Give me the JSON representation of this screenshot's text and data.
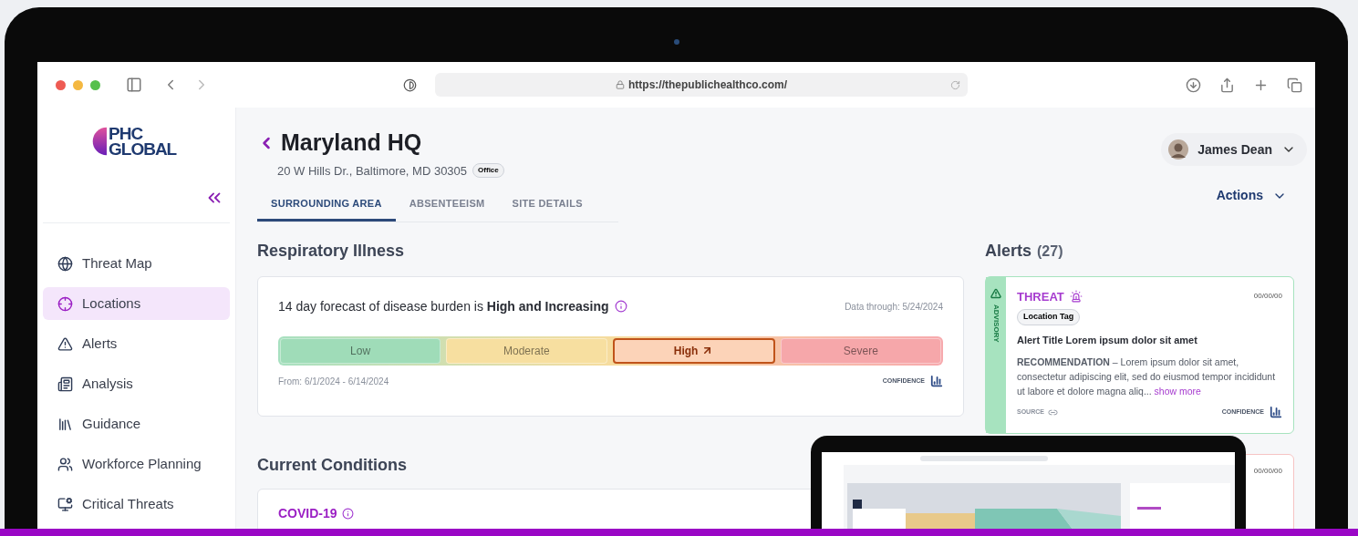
{
  "browser": {
    "url": "https://thepublichealthco.com/"
  },
  "sidebar": {
    "logo": [
      "PHC",
      "GLOBAL"
    ],
    "items": [
      {
        "label": "Threat Map",
        "selected": false
      },
      {
        "label": "Locations",
        "selected": true
      },
      {
        "label": "Alerts",
        "selected": false
      },
      {
        "label": "Analysis",
        "selected": false
      },
      {
        "label": "Guidance",
        "selected": false
      },
      {
        "label": "Workforce Planning",
        "selected": false
      },
      {
        "label": "Critical Threats",
        "selected": false
      }
    ]
  },
  "header": {
    "title": "Maryland HQ",
    "address": "20 W Hills Dr., Baltimore, MD 30305",
    "tag": "Office",
    "user": "James Dean",
    "actions": "Actions",
    "tabs": [
      {
        "label": "SURROUNDING AREA",
        "selected": true
      },
      {
        "label": "ABSENTEEISM",
        "selected": false
      },
      {
        "label": "SITE DETAILS",
        "selected": false
      }
    ]
  },
  "respiratory": {
    "heading": "Respiratory Illness",
    "forecast": "14 day forecast of disease burden is **High and Increasing**",
    "data_through": "Data through: 5/24/2024",
    "range": "From: 6/1/2024 - 6/14/2024",
    "confidence": "CONFIDENCE",
    "levels": [
      {
        "label": "Low",
        "color": "#9fdcb8",
        "selected": false
      },
      {
        "label": "Moderate",
        "color": "#f7dfa0",
        "selected": false
      },
      {
        "label": "High",
        "color": "#fcd3b8",
        "selected": true
      },
      {
        "label": "Severe",
        "color": "#f6a7aa",
        "selected": false
      }
    ]
  },
  "current_conditions": {
    "heading": "Current Conditions",
    "items": [
      "COVID-19"
    ]
  },
  "alerts": {
    "heading": "Alerts",
    "count": "(27)",
    "items": [
      {
        "color": "#a7e3bf",
        "type": "THREAT",
        "side_label": "ADVISORY",
        "tag": "Location Tag",
        "date": "00/00/00",
        "title": "Alert Title Lorem ipsum dolor sit amet",
        "recommendation": "**RECOMMENDATION** – Lorem ipsum dolor sit amet, consectetur adipiscing elit, sed do eiusmod tempor incididunt ut labore et dolore magna aliq...",
        "show_more": "show more",
        "source": "SOURCE",
        "confidence": "CONFIDENCE"
      },
      {
        "color": "#f6c4c4",
        "date": "00/00/00"
      }
    ]
  }
}
